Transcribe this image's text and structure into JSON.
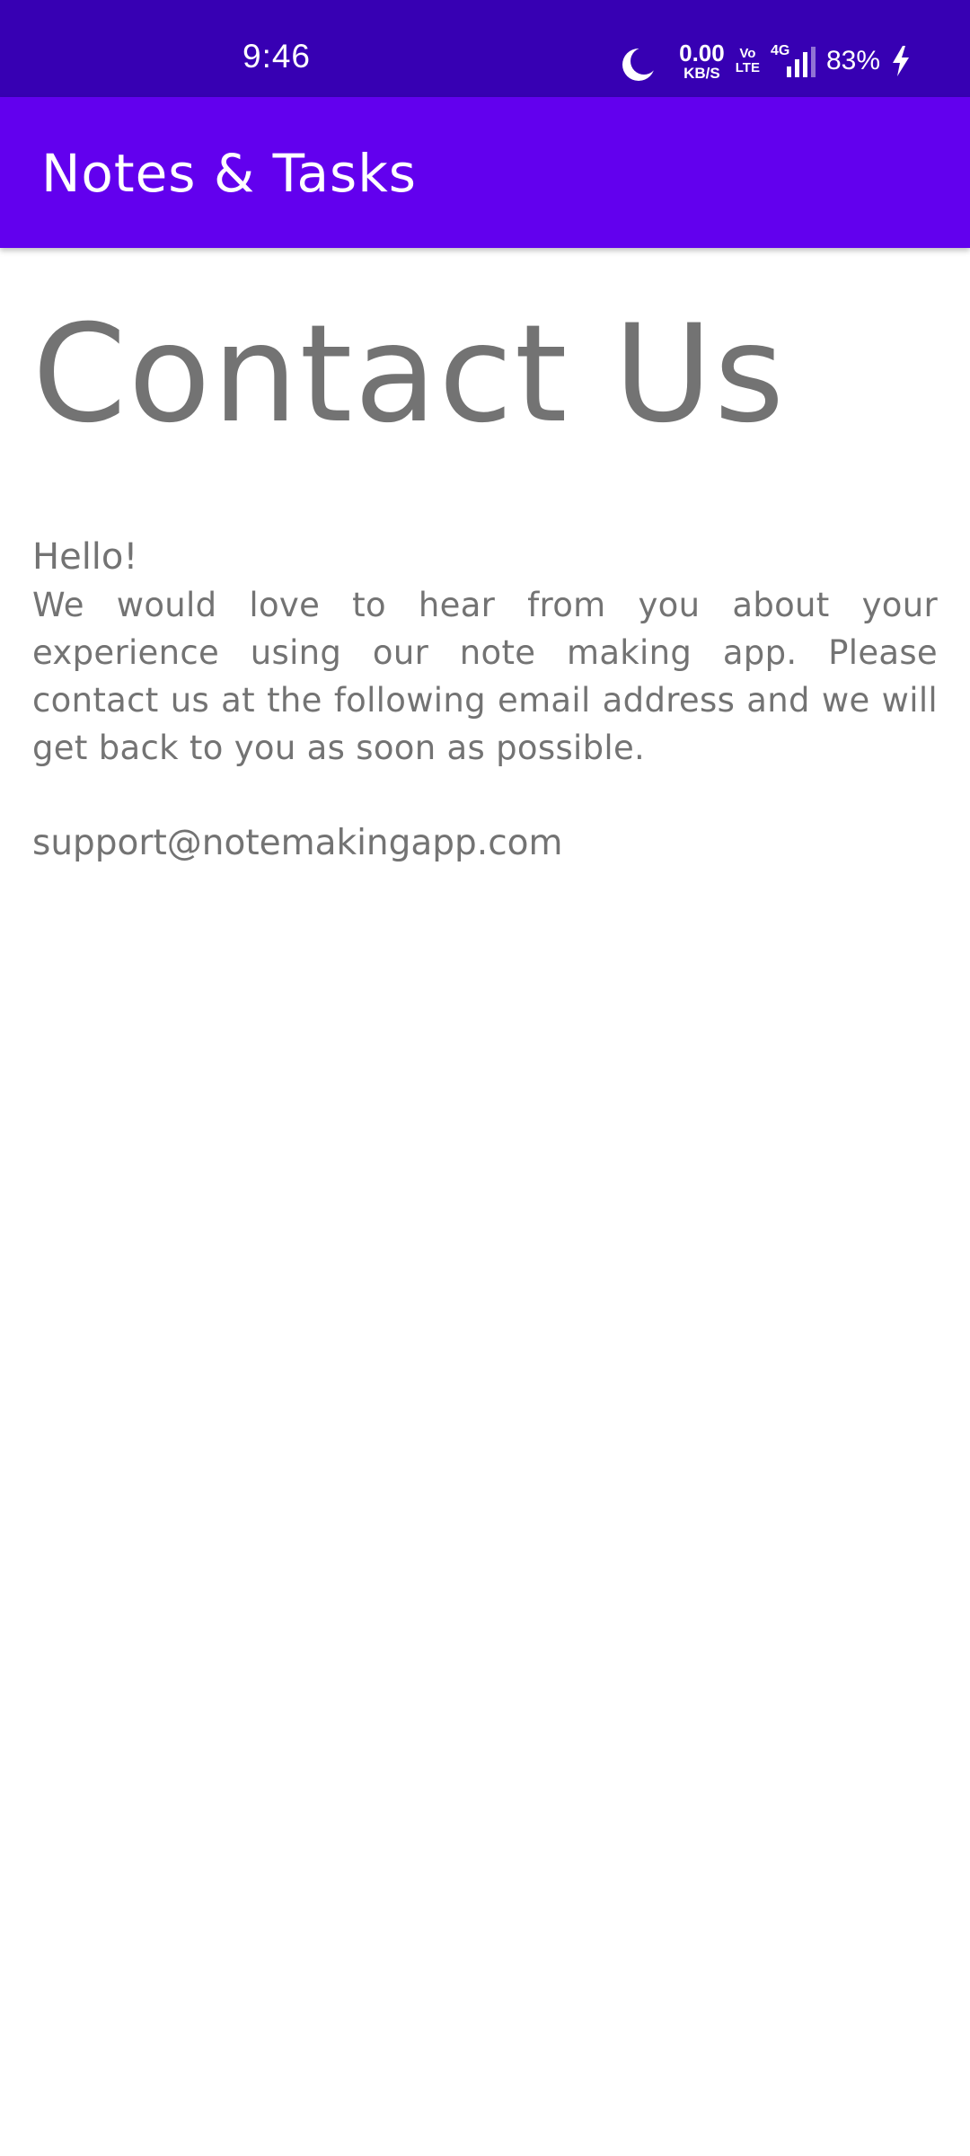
{
  "status_bar": {
    "time": "9:46",
    "net_speed_value": "0.00",
    "net_speed_unit": "KB/S",
    "volte_top": "Vo",
    "volte_bottom": "LTE",
    "network_type": "4G",
    "battery": "83%",
    "icons": [
      "moon-icon",
      "signal-icon",
      "bolt-icon"
    ]
  },
  "app_bar": {
    "title": "Notes & Tasks"
  },
  "content": {
    "heading": "Contact Us",
    "greeting": "Hello!",
    "body": "We would love to hear from you about your experience using our note making app. Please contact us at the following email address and we will get back to you as soon as possible.",
    "email": "support@notemakingapp.com"
  },
  "colors": {
    "status_bar": "#3700b3",
    "app_bar": "#6200ee",
    "text": "#737373",
    "background": "#ffffff"
  }
}
